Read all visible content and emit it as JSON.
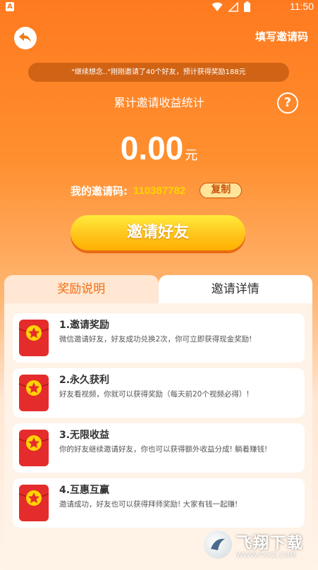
{
  "status_bar": {
    "app_letter": "A",
    "time": "11:50"
  },
  "header": {
    "fill_code_label": "填写邀请码"
  },
  "ticker": {
    "text": "\"继续想念..\"刚刚邀请了40个好友，预计获得奖励188元"
  },
  "stats": {
    "title": "累计邀请收益统计",
    "help_symbol": "?",
    "amount": "0.00",
    "unit": "元"
  },
  "invite_code": {
    "label": "我的邀请码:",
    "value": "110387782",
    "copy_label": "复制"
  },
  "invite_button": {
    "label": "邀请好友"
  },
  "tabs": [
    {
      "label": "奖励说明",
      "active": true
    },
    {
      "label": "邀请详情",
      "active": false
    }
  ],
  "rewards": [
    {
      "title": "1.邀请奖励",
      "desc": "微信邀请好友，好友成功兑换2次，你可立即获得现金奖励!"
    },
    {
      "title": "2.永久获利",
      "desc": "好友看视频，你就可以获得奖励（每天前20个视频必得）!"
    },
    {
      "title": "3.无限收益",
      "desc": "你的好友继续邀请好友，你也可以获得额外收益分成! 躺着赚钱!"
    },
    {
      "title": "4.互惠互赢",
      "desc": "邀请成功，好友也可以获得拜师奖励! 大家有钱一起赚!"
    }
  ],
  "watermark": {
    "title": "飞翔下载",
    "url": "WWW.FXXZ.COM"
  },
  "colors": {
    "accent": "#ff7a1f",
    "gold": "#ffd400",
    "red_packet": "#e52c2c"
  },
  "icons": [
    "wifi-icon",
    "signal-icon",
    "battery-icon",
    "back-arrow-icon",
    "question-icon",
    "red-packet-star-icon"
  ]
}
